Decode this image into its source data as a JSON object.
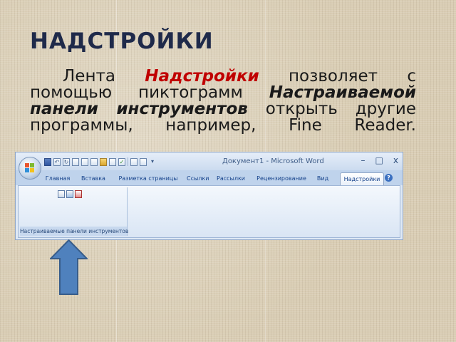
{
  "slide": {
    "title": "НАДСТРОЙКИ",
    "body": {
      "t1": "Лента ",
      "kw1": "Надстройки",
      "t2": " позволяет с помощью пиктограмм ",
      "kw2": "Настраиваемой панели инструментов",
      "t3": " открыть другие программы, например, Fine Reader."
    }
  },
  "word": {
    "window_title": "Документ1 - Microsoft Word",
    "controls": {
      "minimize": "–",
      "maximize": "□",
      "close": "x"
    },
    "tabs": [
      {
        "label": "Главная"
      },
      {
        "label": "Вставка"
      },
      {
        "label": "Разметка страницы"
      },
      {
        "label": "Ссылки"
      },
      {
        "label": "Рассылки"
      },
      {
        "label": "Рецензирование"
      },
      {
        "label": "Вид"
      },
      {
        "label": "Надстройки"
      }
    ],
    "help": "?",
    "group_label": "Настраиваемые панели инструментов",
    "colors": {
      "accent": "#15428b",
      "active_tab_text": "#c00000"
    }
  }
}
